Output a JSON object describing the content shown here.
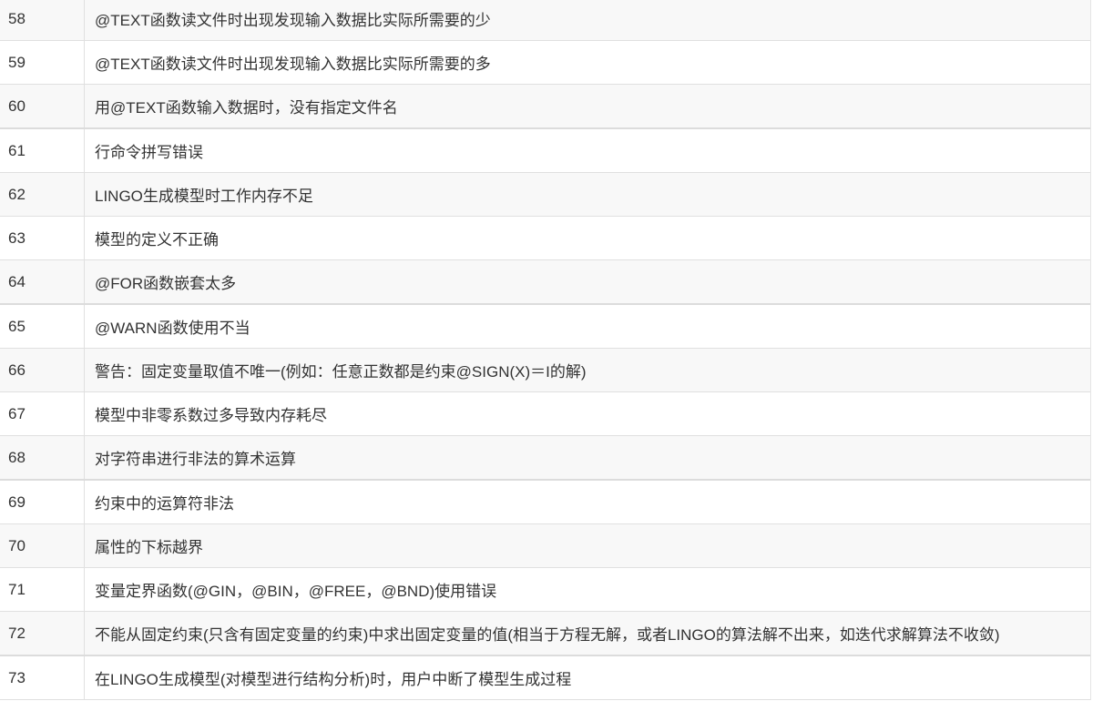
{
  "rows": [
    {
      "num": "58",
      "desc": "@TEXT函数读文件时出现发现输入数据比实际所需要的少"
    },
    {
      "num": "59",
      "desc": "@TEXT函数读文件时出现发现输入数据比实际所需要的多"
    },
    {
      "num": "60",
      "desc": "用@TEXT函数输入数据时，没有指定文件名"
    },
    {
      "num": "61",
      "desc": "行命令拼写错误"
    },
    {
      "num": "62",
      "desc": "LINGO生成模型时工作内存不足"
    },
    {
      "num": "63",
      "desc": "模型的定义不正确"
    },
    {
      "num": "64",
      "desc": "@FOR函数嵌套太多"
    },
    {
      "num": "65",
      "desc": "@WARN函数使用不当"
    },
    {
      "num": "66",
      "desc": "警告：固定变量取值不唯一(例如：任意正数都是约束@SIGN(X)＝I的解)"
    },
    {
      "num": "67",
      "desc": "模型中非零系数过多导致内存耗尽"
    },
    {
      "num": "68",
      "desc": "对字符串进行非法的算术运算"
    },
    {
      "num": "69",
      "desc": "约束中的运算符非法"
    },
    {
      "num": "70",
      "desc": "属性的下标越界"
    },
    {
      "num": "71",
      "desc": "变量定界函数(@GIN，@BIN，@FREE，@BND)使用错误"
    },
    {
      "num": "72",
      "desc": "不能从固定约束(只含有固定变量的约束)中求出固定变量的值(相当于方程无解，或者LINGO的算法解不出来，如迭代求解算法不收敛)"
    },
    {
      "num": "73",
      "desc": "在LINGO生成模型(对模型进行结构分析)时，用户中断了模型生成过程"
    }
  ]
}
